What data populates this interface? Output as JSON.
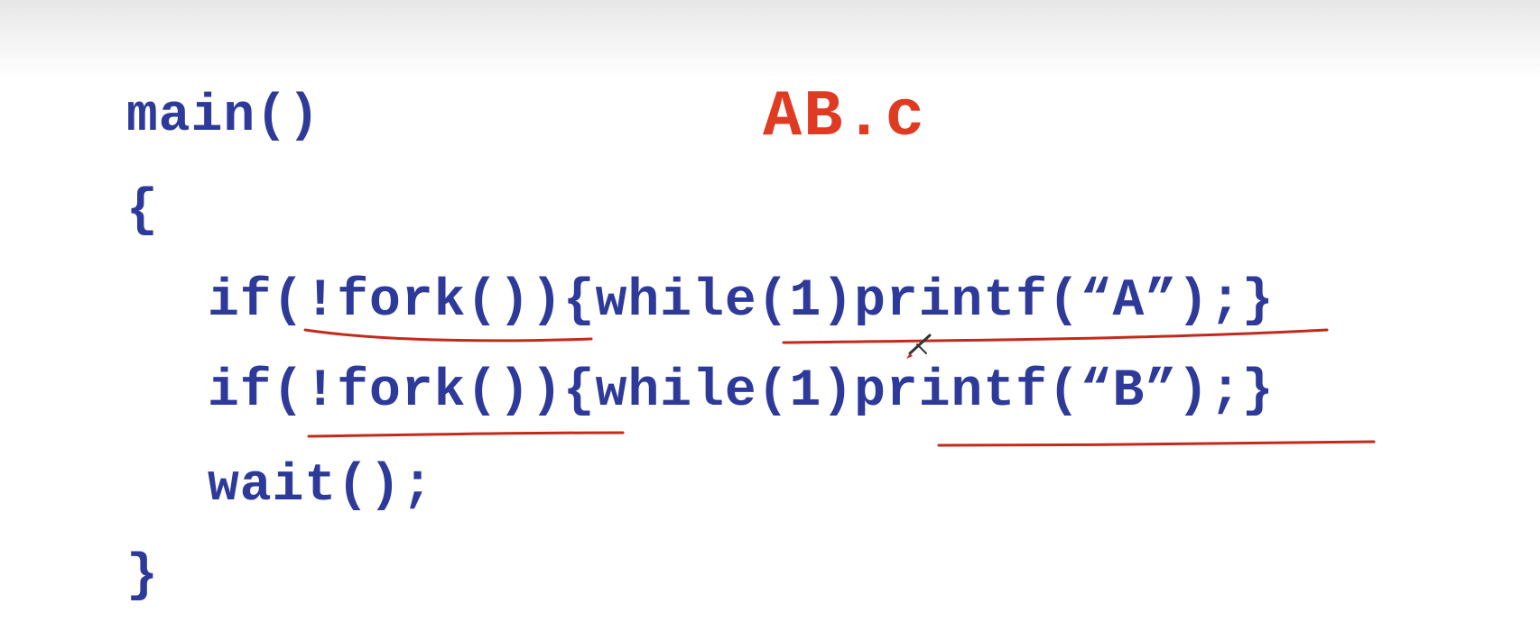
{
  "slide": {
    "file_title": "AB.c",
    "code_lines": [
      "main()",
      "{",
      "if(!fork()){while(1)printf(“A”);}",
      "if(!fork()){while(1)printf(“B”);}",
      "wait();",
      "}"
    ]
  },
  "colors": {
    "code_text": "#2e3a9a",
    "title_text": "#e03a22",
    "annotation_ink": "#c42a1c"
  },
  "icons": {
    "cursor": "pen-cursor-icon"
  }
}
